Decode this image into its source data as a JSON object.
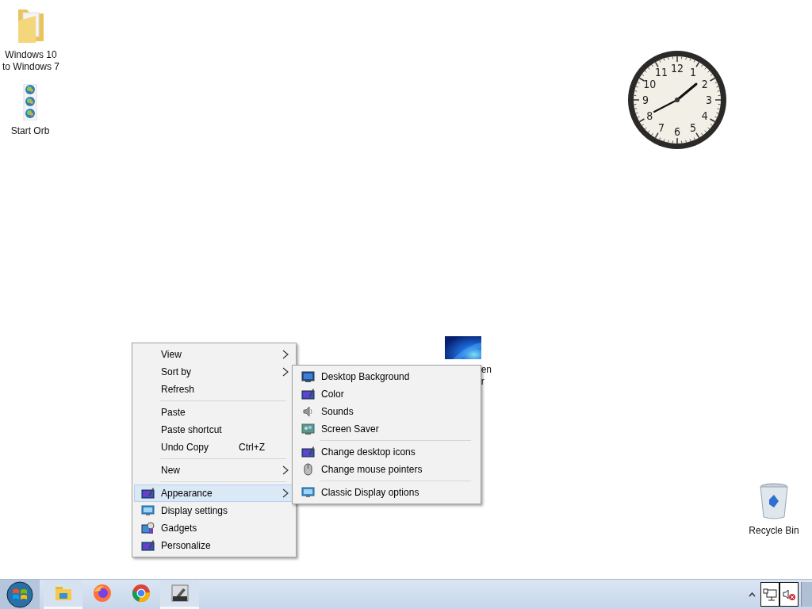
{
  "desktop_icons": [
    {
      "kind": "folder",
      "lines": [
        "Windows 10",
        "to Windows 7"
      ]
    },
    {
      "kind": "orbs",
      "lines": [
        "Start Orb"
      ]
    },
    {
      "kind": "wallpaper",
      "lines": [
        "en",
        "r"
      ]
    },
    {
      "kind": "recycle",
      "lines": [
        "Recycle Bin"
      ]
    }
  ],
  "clock": {
    "numerals": [
      "11",
      "12",
      "1",
      "10",
      "2",
      "9",
      "3",
      "8",
      "4",
      "7",
      "6",
      "5"
    ]
  },
  "context_menu": {
    "groups": [
      [
        {
          "label": "View",
          "submenu": true,
          "selected": false
        },
        {
          "label": "Sort by",
          "submenu": true,
          "selected": false
        },
        {
          "label": "Refresh",
          "submenu": false,
          "selected": false
        }
      ],
      [
        {
          "label": "Paste",
          "submenu": false,
          "selected": false
        },
        {
          "label": "Paste shortcut",
          "submenu": false,
          "selected": false
        },
        {
          "label": "Undo Copy",
          "shortcut": "Ctrl+Z",
          "submenu": false,
          "selected": false
        }
      ],
      [
        {
          "label": "New",
          "submenu": true,
          "selected": false
        }
      ],
      [
        {
          "label": "Appearance",
          "kind": "color",
          "submenu": true,
          "selected": true
        },
        {
          "label": "Display settings",
          "kind": "monitor",
          "submenu": false,
          "selected": false
        },
        {
          "label": "Gadgets",
          "kind": "gadgets",
          "submenu": false,
          "selected": false
        },
        {
          "label": "Personalize",
          "kind": "color",
          "submenu": false,
          "selected": false
        }
      ]
    ]
  },
  "submenu": {
    "groups": [
      [
        {
          "label": "Desktop Background",
          "kind": "background",
          "selected": false
        },
        {
          "label": "Color",
          "kind": "color",
          "selected": false
        },
        {
          "label": "Sounds",
          "kind": "speaker",
          "selected": false
        },
        {
          "label": "Screen Saver",
          "kind": "saver",
          "selected": false
        }
      ],
      [
        {
          "label": "Change desktop icons",
          "kind": "color",
          "selected": false
        },
        {
          "label": "Change mouse pointers",
          "kind": "mouse",
          "selected": false
        }
      ],
      [
        {
          "label": "Classic Display options",
          "kind": "monitor",
          "selected": false
        }
      ]
    ]
  },
  "taskbar": {
    "apps": [
      {
        "kind": "folder",
        "running": true
      },
      {
        "kind": "firefox",
        "running": false
      },
      {
        "kind": "chrome",
        "running": false
      },
      {
        "kind": "tool",
        "running": true
      }
    ],
    "tray": [
      {
        "kind": "overflow"
      },
      {
        "kind": "network"
      },
      {
        "kind": "volume-muted"
      }
    ]
  }
}
